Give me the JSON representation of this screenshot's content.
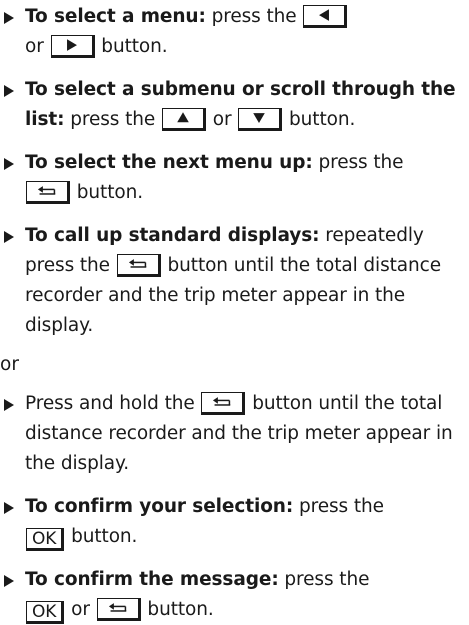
{
  "items": [
    {
      "lead": "To select a menu:",
      "t1": "press the",
      "t2": "or",
      "t3": "button.",
      "k1_icon": "left-arrow-icon",
      "k2_icon": "right-arrow-icon"
    },
    {
      "lead": "To select a submenu or scroll through the list:",
      "t1": "press the",
      "t2": "or",
      "t3": "button.",
      "k1_icon": "up-arrow-icon",
      "k2_icon": "down-arrow-icon"
    },
    {
      "lead": "To select the next menu up:",
      "t1": "press the",
      "t2": "button.",
      "k1_icon": "back-icon"
    },
    {
      "lead": "To call up standard displays:",
      "t1": "repeatedly press the",
      "t2": "button until the total distance recorder and the trip meter appear in the display.",
      "k1_icon": "back-icon"
    },
    {
      "t1": "Press and hold the",
      "t2": "button until the total distance recorder and the trip meter appear in the display.",
      "k1_icon": "back-icon"
    },
    {
      "lead": "To confirm your selection:",
      "t1": "press the",
      "ok": "OK",
      "t2": "button."
    },
    {
      "lead": "To confirm the message:",
      "t1": "press the",
      "ok": "OK",
      "t2": "or",
      "t3": "button.",
      "k1_icon": "back-icon"
    }
  ],
  "or_text": "or"
}
